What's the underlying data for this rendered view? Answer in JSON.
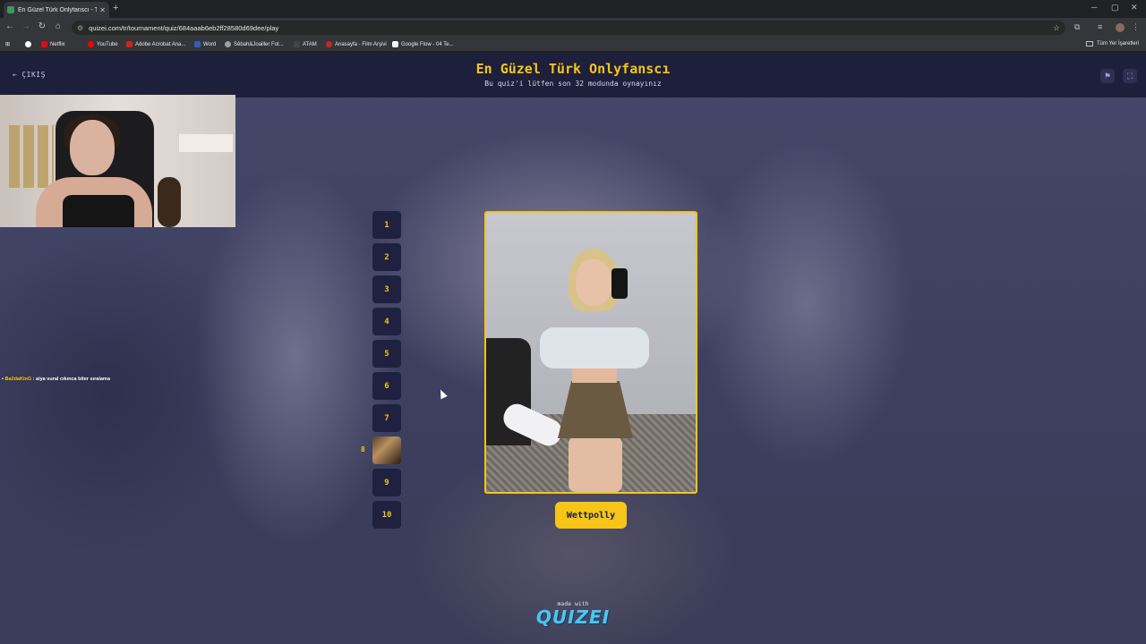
{
  "browser": {
    "tab_title": "En Güzel Türk Onlyfanscı - Tier",
    "tab_close": "✕",
    "new_tab": "+",
    "url": "quizei.com/tr/tournament/quiz/684aaab6eb2ff28580d69dee/play",
    "window_controls": {
      "minimize": "─",
      "maximize": "▢",
      "close": "✕"
    },
    "bookmarks": [
      {
        "label": "Netflix",
        "color": "#e50914"
      },
      {
        "label": "YouTube",
        "color": "#ff0000"
      },
      {
        "label": "Adobe Acrobat Ana...",
        "color": "#d4231a"
      },
      {
        "label": "Word",
        "color": "#2b5fbe"
      },
      {
        "label": "Sêbah&Joailler Fot...",
        "color": "#9e9e9e"
      },
      {
        "label": "ATAM",
        "color": "#444444"
      },
      {
        "label": "Anasayfa - Film Arşivi",
        "color": "#c62828"
      },
      {
        "label": "Google Flow - 04 Te...",
        "color": "#ffffff"
      }
    ],
    "all_bookmarks": "Tüm Yer İşaretleri"
  },
  "header": {
    "exit_label": "ÇIKIŞ",
    "title": "En Güzel Türk Onlyfanscı",
    "subtitle": "Bu quiz'i lütfen son 32 modunda oynayınız",
    "flag_icon": "flag-icon",
    "fullscreen_icon": "fullscreen-icon"
  },
  "chat": {
    "user": "Ba2daKinG",
    "message": ": aiya vural cıkınca biter sıralama"
  },
  "ladder": {
    "rungs": [
      "1",
      "2",
      "3",
      "4",
      "5",
      "6",
      "7",
      "",
      "9",
      "10"
    ],
    "current_marker": "8",
    "current_index": 8
  },
  "candidate": {
    "name": "Wettpolly"
  },
  "footer": {
    "made_with": "made with",
    "brand": "QUIZEI"
  },
  "colors": {
    "accent": "#f5c518",
    "header_bg": "#1d1f3b",
    "rung_bg": "#1f2140",
    "brand": "#48c7f0"
  }
}
